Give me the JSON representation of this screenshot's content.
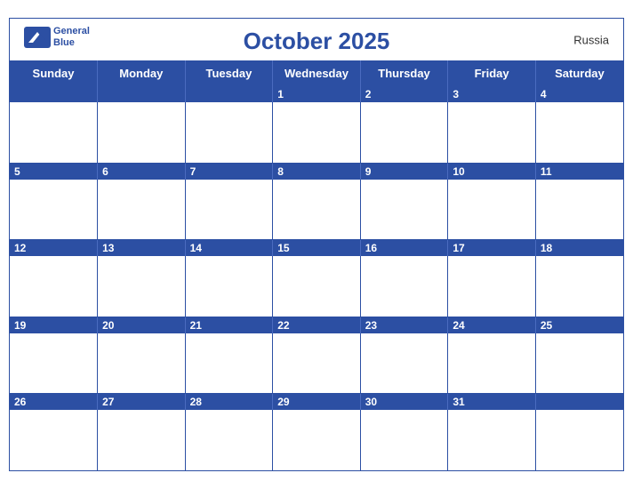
{
  "header": {
    "title": "October 2025",
    "country": "Russia",
    "logo_general": "General",
    "logo_blue": "Blue"
  },
  "days": [
    "Sunday",
    "Monday",
    "Tuesday",
    "Wednesday",
    "Thursday",
    "Friday",
    "Saturday"
  ],
  "weeks": [
    {
      "dates": [
        "",
        "",
        "",
        "1",
        "2",
        "3",
        "4"
      ]
    },
    {
      "dates": [
        "5",
        "6",
        "7",
        "8",
        "9",
        "10",
        "11"
      ]
    },
    {
      "dates": [
        "12",
        "13",
        "14",
        "15",
        "16",
        "17",
        "18"
      ]
    },
    {
      "dates": [
        "19",
        "20",
        "21",
        "22",
        "23",
        "24",
        "25"
      ]
    },
    {
      "dates": [
        "26",
        "27",
        "28",
        "29",
        "30",
        "31",
        ""
      ]
    }
  ],
  "colors": {
    "blue": "#2c4fa3",
    "light_blue_row": "#dce6f7",
    "white": "#ffffff"
  }
}
